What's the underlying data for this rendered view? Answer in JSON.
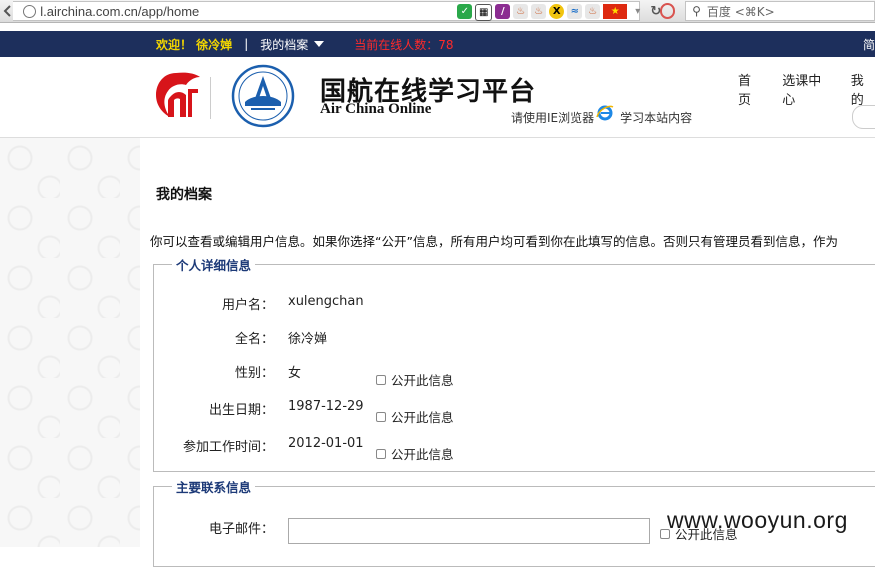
{
  "browser": {
    "url": "l.airchina.com.cn/app/home",
    "search_placeholder": "百度 <⌘K>"
  },
  "topbar": {
    "welcome": "欢迎！ 徐冷婵",
    "separator": "|",
    "profile_menu": "我的档案",
    "online_count": "当前在线人数：78",
    "simplified": "简"
  },
  "header": {
    "site_title_cn": "国航在线学习平台",
    "site_title_en": "Air China Online",
    "ie_note_before": "请使用IE浏览器",
    "ie_note_after": "学习本站内容",
    "nav": [
      "首页",
      "选课中心",
      "我的"
    ]
  },
  "page": {
    "title": "我的档案",
    "intro": "你可以查看或编辑用户信息。如果你选择“公开”信息，所有用户均可看到你在此填写的信息。否则只有管理员看到信息，作为"
  },
  "personal": {
    "legend": "个人详细信息",
    "public_label": "公开此信息",
    "fields": [
      {
        "label": "用户名：",
        "value": "xulengchan",
        "public": false
      },
      {
        "label": "全名：",
        "value": "徐冷婵",
        "public": false
      },
      {
        "label": "性别：",
        "value": "女",
        "public": true
      },
      {
        "label": "出生日期：",
        "value": "1987-12-29",
        "public": true
      },
      {
        "label": "参加工作时间：",
        "value": "2012-01-01",
        "public": true
      }
    ]
  },
  "contact": {
    "legend": "主要联系信息",
    "email_label": "电子邮件：",
    "email_value": "",
    "public_label": "公开此信息"
  },
  "watermark": "www.wooyun.org",
  "colors": {
    "nav_bg": "#1d2f5c",
    "welcome": "#f2d600",
    "online": "#ff2a2a",
    "legend": "#1d3a78",
    "brand_red": "#d7141a",
    "seal_blue": "#1b5fae"
  }
}
